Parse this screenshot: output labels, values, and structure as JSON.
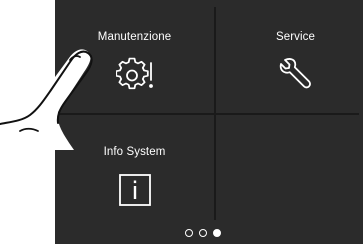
{
  "tiles": [
    {
      "label": "Manutenzione",
      "icon": "gear-alert-icon"
    },
    {
      "label": "Service",
      "icon": "wrench-icon"
    },
    {
      "label": "Info System",
      "icon": "info-icon"
    }
  ],
  "pager": {
    "pages": 3,
    "active_index": 2
  },
  "colors": {
    "screen_bg": "#2b2b2b",
    "divider": "#1a1a1a",
    "foreground": "#ffffff"
  }
}
